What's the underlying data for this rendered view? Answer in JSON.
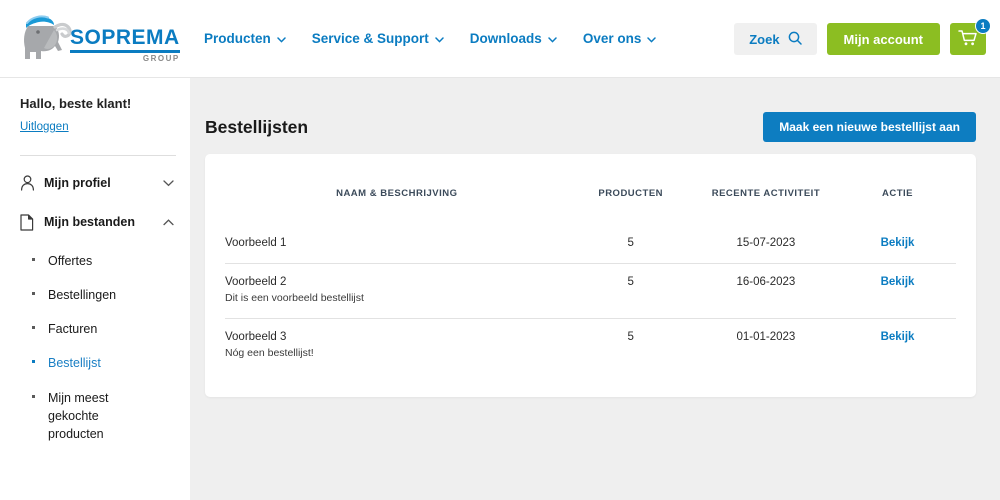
{
  "header": {
    "logo": {
      "brand": "SOPREMA",
      "suffix": "GROUP",
      "icon": "elephant-logo"
    },
    "nav": [
      {
        "label": "Producten",
        "icon": "chevron-down-icon"
      },
      {
        "label": "Service & Support",
        "icon": "chevron-down-icon"
      },
      {
        "label": "Downloads",
        "icon": "chevron-down-icon"
      },
      {
        "label": "Over ons",
        "icon": "chevron-down-icon"
      }
    ],
    "search_label": "Zoek",
    "account_label": "Mijn account",
    "cart_count": "1"
  },
  "sidebar": {
    "greeting": "Hallo, beste klant!",
    "logout": "Uitloggen",
    "sections": [
      {
        "label": "Mijn profiel",
        "icon": "user-icon",
        "caret": "chevron-down-icon",
        "expanded": false
      },
      {
        "label": "Mijn bestanden",
        "icon": "document-icon",
        "caret": "chevron-up-icon",
        "expanded": true
      }
    ],
    "subitems": [
      {
        "label": "Offertes",
        "active": false
      },
      {
        "label": "Bestellingen",
        "active": false
      },
      {
        "label": "Facturen",
        "active": false
      },
      {
        "label": "Bestellijst",
        "active": true
      },
      {
        "label": "Mijn meest gekochte producten",
        "active": false
      }
    ]
  },
  "main": {
    "title": "Bestellijsten",
    "new_list_button": "Maak een nieuwe bestellijst aan",
    "table": {
      "columns": [
        "NAAM & BESCHRIJVING",
        "PRODUCTEN",
        "RECENTE ACTIVITEIT",
        "ACTIE"
      ],
      "rows": [
        {
          "name": "Voorbeeld 1",
          "description": "",
          "products": "5",
          "activity": "15-07-2023",
          "action": "Bekijk"
        },
        {
          "name": "Voorbeeld 2",
          "description": "Dit is een voorbeeld bestellijst",
          "products": "5",
          "activity": "16-06-2023",
          "action": "Bekijk"
        },
        {
          "name": "Voorbeeld 3",
          "description": "Nóg een bestellijst!",
          "products": "5",
          "activity": "01-01-2023",
          "action": "Bekijk"
        }
      ]
    }
  },
  "colors": {
    "brand_blue": "#0b7cc1",
    "accent_green": "#8cbe22",
    "button_blue": "#0d7dc1",
    "page_bg": "#efefef"
  }
}
